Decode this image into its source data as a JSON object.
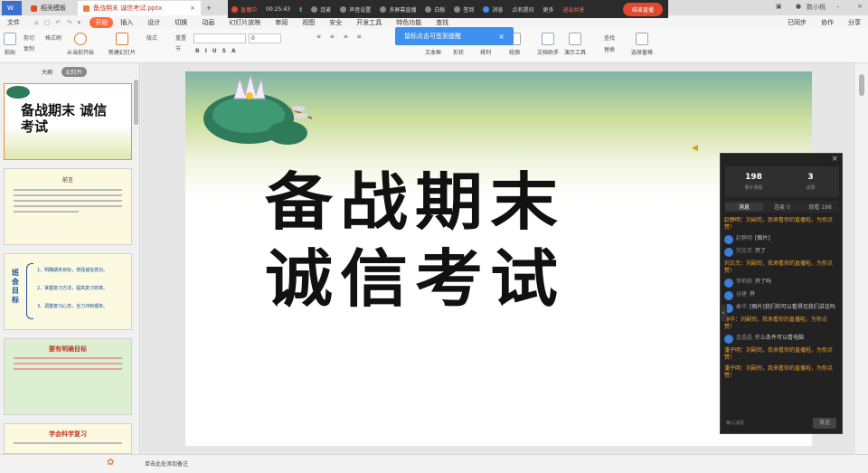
{
  "tabs": {
    "home": "稻壳模板",
    "document": "备战期末 诚信考试.pptx"
  },
  "top_right": {
    "user": "数小桃"
  },
  "ribbon_tabs": [
    "文件",
    "开始",
    "插入",
    "设计",
    "切换",
    "动画",
    "幻灯片放映",
    "审阅",
    "视图",
    "安全",
    "开发工具",
    "特色功能",
    "查找"
  ],
  "share": {
    "sync": "已同步",
    "collab": "协作",
    "share": "分享"
  },
  "ribbon": {
    "paste": "粘贴",
    "cut": "剪切",
    "copy": "复制",
    "format": "格式刷",
    "play": "从当前开始",
    "new_slide": "新建幻灯片",
    "layout": "版式",
    "reset": "重置",
    "section": "节",
    "font_size": "0",
    "textbox": "文本框",
    "shape": "形状",
    "arrange": "排列",
    "outline": "轮廓",
    "assistant": "文档助手",
    "tools": "演示工具",
    "find": "查找",
    "replace": "替换",
    "select": "选择窗格"
  },
  "livebar": {
    "status": "直播中",
    "timer": "00:25:43",
    "items": [
      "连麦",
      "声音设置",
      "多屏幕直播",
      "白板",
      "签到",
      "消息",
      "点名提问",
      "更多"
    ],
    "quit": "退出共享",
    "end": "结束直播"
  },
  "tooltip": "鼠标点击可签到提醒",
  "left_panel": {
    "tab_outline": "大纲",
    "tab_slides": "幻灯片"
  },
  "thumbs": {
    "t1_title": "备战期末 诚信考试",
    "t2_head": "前言",
    "t3_side": "班会目标",
    "t3_lines": [
      "1、明确期末目标，增强诚信意识。",
      "2、掌握复习方法，提高复习效率。",
      "3、调整复习心态，全力冲刺期末。"
    ],
    "t4_head": "要有明确目标",
    "t5_head": "学会科学复习"
  },
  "slide": {
    "title_line1": "备战期末",
    "title_line2": "诚信考试"
  },
  "chat": {
    "stats": [
      {
        "value": "198",
        "label": "累计观看"
      },
      {
        "value": "3",
        "label": "点赞"
      }
    ],
    "tabs": [
      "消息",
      "连麦 0",
      "观看 198"
    ],
    "messages": [
      {
        "type": "sys",
        "name": "",
        "text": "赵静明：刘副司，我来看你的直播啦，为你点赞！"
      },
      {
        "type": "user",
        "name": "赵静明",
        "text": "[图片]"
      },
      {
        "type": "user",
        "name": "刘文杰",
        "text": "开了"
      },
      {
        "type": "sys",
        "name": "",
        "text": "刘文杰：刘副司，我来看你的直播啦，为你点赞！"
      },
      {
        "type": "user",
        "name": "李莉莉",
        "text": "开了吗"
      },
      {
        "type": "user",
        "name": "谷建",
        "text": "开"
      },
      {
        "type": "user",
        "name": "秦华",
        "text": "[图片]我们的可以看得见我们讲话吗"
      },
      {
        "type": "sys",
        "name": "",
        "text": "秦华：刘副司，我来看你的直播啦，为你点赞！"
      },
      {
        "type": "user",
        "name": "金晶晶",
        "text": "什么条件可以看电脑"
      },
      {
        "type": "sys",
        "name": "",
        "text": "潘子明：刘副司，我来看你的直播啦，为你点赞！"
      },
      {
        "type": "sys",
        "name": "",
        "text": "潘子明：刘副司，我来看你的直播啦，为你点赞！"
      }
    ],
    "input_placeholder": "输入消息",
    "send": "发送"
  },
  "status": {
    "note": "单击此处添加备注"
  }
}
